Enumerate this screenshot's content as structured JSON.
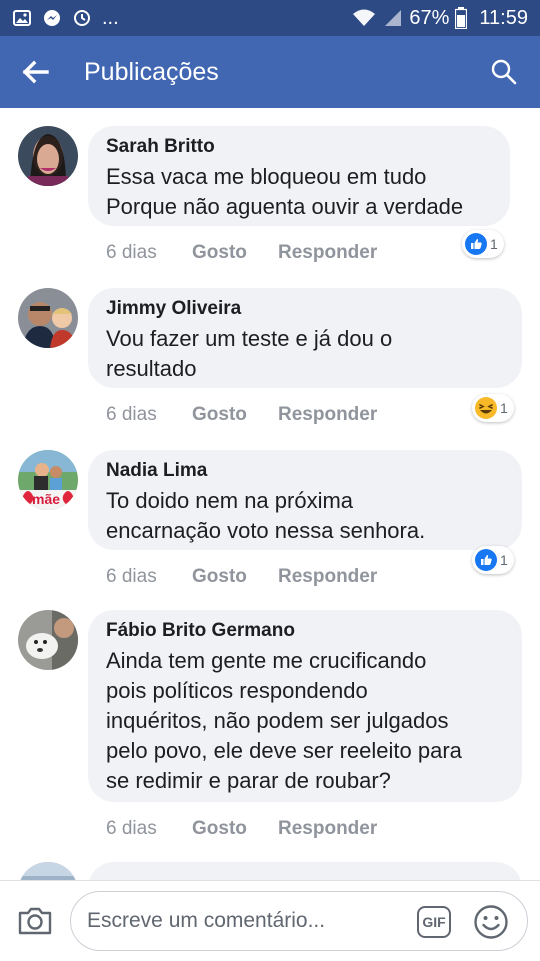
{
  "status_bar": {
    "notification_icons": [
      "image-icon",
      "messenger-icon",
      "clock-sync-icon"
    ],
    "more_indicator": "...",
    "battery_percent": "67%",
    "time": "11:59"
  },
  "app_bar": {
    "title": "Publicações"
  },
  "comments": [
    {
      "author": "Sarah Britto",
      "text_lines": [
        "Essa vaca me bloqueou em tudo",
        "Porque não aguenta ouvir a verdade"
      ],
      "time": "6 dias",
      "like_label": "Gosto",
      "reply_label": "Responder",
      "reaction": {
        "type": "like",
        "count": "1"
      }
    },
    {
      "author": "Jimmy Oliveira",
      "text_lines": [
        "Vou fazer um teste e já dou o",
        "resultado"
      ],
      "time": "6 dias",
      "like_label": "Gosto",
      "reply_label": "Responder",
      "reaction": {
        "type": "haha",
        "count": "1"
      }
    },
    {
      "author": "Nadia Lima",
      "text_lines": [
        "To doido nem na próxima",
        "encarnação voto nessa senhora."
      ],
      "time": "6 dias",
      "like_label": "Gosto",
      "reply_label": "Responder",
      "reaction": {
        "type": "like",
        "count": "1"
      },
      "avatar_text": "mãe"
    },
    {
      "author": "Fábio Brito Germano",
      "text_lines": [
        "Ainda tem gente me crucificando",
        "pois políticos respondendo",
        "inquéritos, não podem ser julgados",
        "pelo povo, ele deve ser reeleito para",
        "se redimir e parar de roubar?"
      ],
      "time": "6 dias",
      "like_label": "Gosto",
      "reply_label": "Responder"
    }
  ],
  "composer": {
    "placeholder": "Escreve um comentário...",
    "gif_label": "GIF"
  },
  "colors": {
    "status_bar": "#2d4a85",
    "app_bar": "#4267b2",
    "like_blue": "#1877f2",
    "haha_yellow": "#f7b928",
    "bubble_bg": "#f0f2f5",
    "meta_gray": "#90949c"
  }
}
